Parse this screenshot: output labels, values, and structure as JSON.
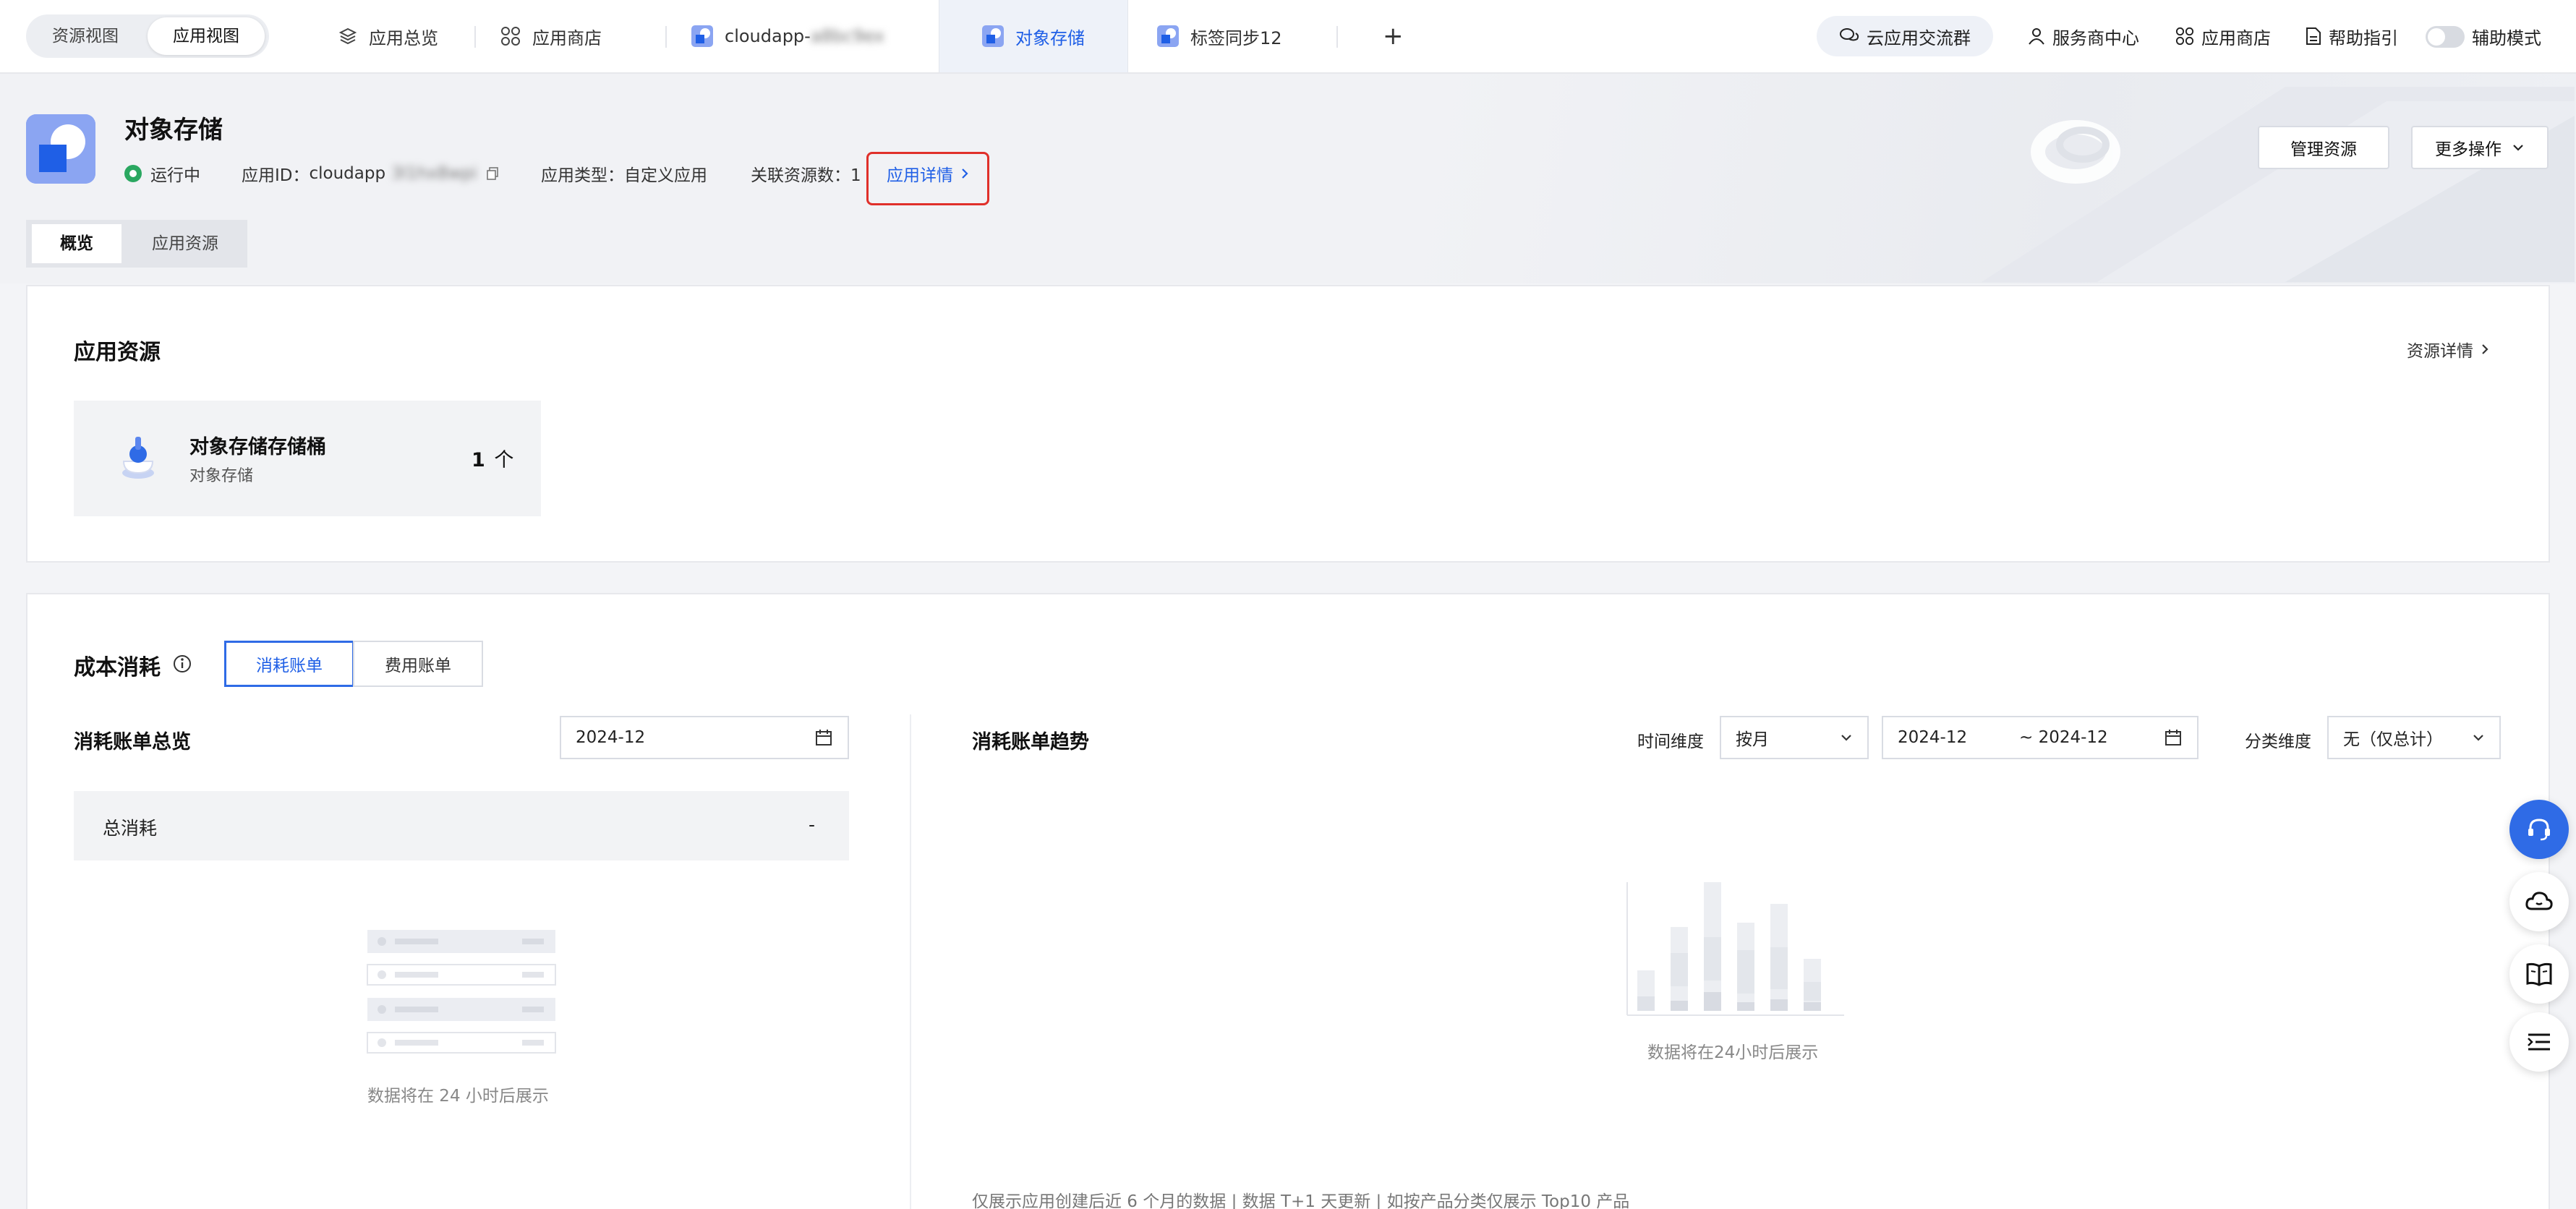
{
  "topbar": {
    "view_switch": {
      "resource_view": "资源视图",
      "app_view": "应用视图"
    },
    "tabs": [
      {
        "label": "应用总览",
        "icon": "layers-icon"
      },
      {
        "label": "应用商店",
        "icon": "apps-grid-icon"
      },
      {
        "label": "cloudapp-",
        "blurred_suffix": "a8bc9ex",
        "icon": "app-tile-icon"
      },
      {
        "label": "对象存储",
        "icon": "app-tile-icon",
        "active": true
      },
      {
        "label": "标签同步12",
        "icon": "app-tile-icon"
      }
    ],
    "add_tab_label": "+",
    "chat_group": "云应用交流群",
    "service_center": "服务商中心",
    "app_store": "应用商店",
    "help": "帮助指引",
    "assist_mode": "辅助模式"
  },
  "header": {
    "title": "对象存储",
    "status": "运行中",
    "app_id_label": "应用ID：",
    "app_id_value": "cloudapp",
    "app_id_blurred": "3l1hx8wpi",
    "app_type": "应用类型：自定义应用",
    "related_resources": "关联资源数：1",
    "app_detail_link": "应用详情",
    "manage_button": "管理资源",
    "more_button": "更多操作"
  },
  "subtabs": {
    "overview": "概览",
    "app_resources": "应用资源"
  },
  "resources": {
    "title": "应用资源",
    "detail_link": "资源详情",
    "card": {
      "name": "对象存储存储桶",
      "type": "对象存储",
      "count": "1",
      "unit": "个"
    }
  },
  "cost": {
    "title": "成本消耗",
    "seg_consumption": "消耗账单",
    "seg_fee": "费用账单",
    "overview_title": "消耗账单总览",
    "month": "2024-12",
    "total_label": "总消耗",
    "total_value": "-",
    "overview_empty": "数据将在 24 小时后展示",
    "trend_title": "消耗账单趋势",
    "time_dim_label": "时间维度",
    "time_dim_value": "按月",
    "range_start": "2024-12",
    "range_end": "~ 2024-12",
    "category_label": "分类维度",
    "category_value": "无（仅总计）",
    "trend_empty": "数据将在24小时后展示",
    "footnote": "仅展示应用创建后近 6 个月的数据 | 数据 T+1 天更新 | 如按产品分类仅展示 Top10 产品"
  },
  "colors": {
    "accent": "#1f5fe6",
    "running": "#2aa760",
    "highlight": "#e0302a"
  }
}
